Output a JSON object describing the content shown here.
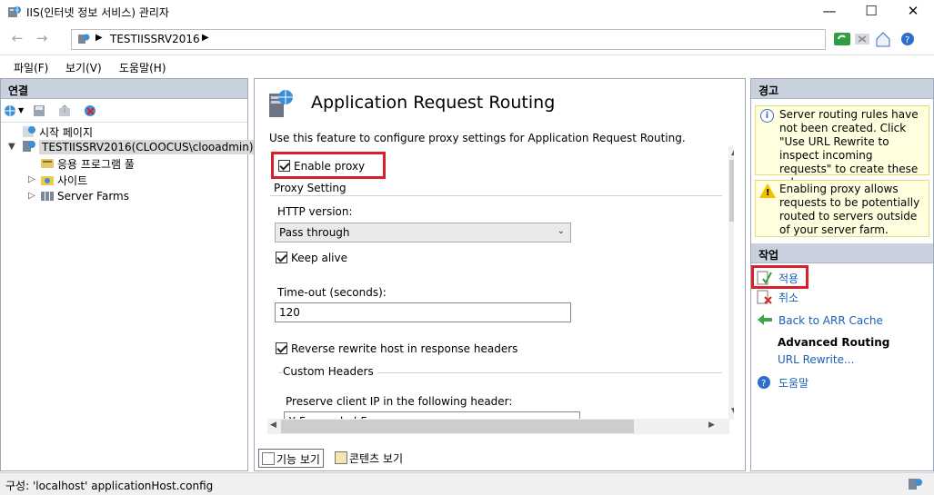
{
  "window": {
    "title": "IIS(인터넷 정보 서비스) 관리자"
  },
  "address": {
    "crumb": "TESTIISSRV2016"
  },
  "menu": {
    "file": "파일(F)",
    "view": "보기(V)",
    "help": "도움말(H)"
  },
  "connections": {
    "header": "연결",
    "tree": [
      {
        "label": "시작 페이지"
      },
      {
        "label": "TESTIISSRV2016(CLOOCUS\\clooadmin)"
      },
      {
        "label": "응용 프로그램 풀"
      },
      {
        "label": "사이트"
      },
      {
        "label": "Server Farms"
      }
    ]
  },
  "feature": {
    "title": "Application Request Routing",
    "description": "Use this feature to configure proxy settings for Application Request Routing.",
    "enable_proxy": {
      "label": "Enable proxy",
      "checked": true
    },
    "proxy_setting_group": "Proxy Setting",
    "http_version_label": "HTTP version:",
    "http_version_value": "Pass through",
    "keep_alive": {
      "label": "Keep alive",
      "checked": true
    },
    "timeout_label": "Time-out (seconds):",
    "timeout_value": "120",
    "reverse_rewrite": {
      "label": "Reverse rewrite host in response headers",
      "checked": true
    },
    "custom_headers_group": "Custom Headers",
    "preserve_ip_label": "Preserve client IP in the following header:",
    "preserve_ip_value": "X-Forwarded-For"
  },
  "view_tabs": {
    "features": "기능 보기",
    "content": "콘텐츠 보기"
  },
  "alerts": {
    "header": "경고",
    "info": "Server routing rules have not been created. Click \"Use URL Rewrite to inspect incoming requests\" to create these rules.",
    "warning": "Enabling proxy allows requests to be potentially routed to servers outside of your server farm."
  },
  "actions": {
    "header": "작업",
    "apply": "적용",
    "cancel": "취소",
    "back": "Back to ARR Cache",
    "advanced_routing": "Advanced Routing",
    "url_rewrite": "URL Rewrite...",
    "help": "도움말"
  },
  "status": {
    "text": "구성: 'localhost' applicationHost.config"
  },
  "colors": {
    "highlight": "#d9202a",
    "panel_header": "#c9d1de",
    "link": "#1a5fb4"
  }
}
